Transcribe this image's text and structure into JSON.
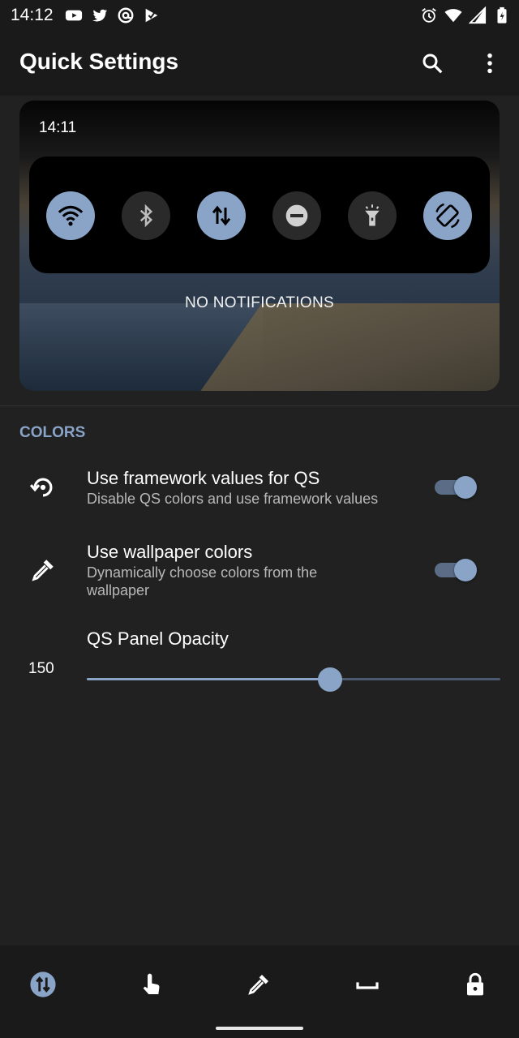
{
  "status_bar": {
    "time": "14:12",
    "left_icons": [
      "youtube-icon",
      "twitter-icon",
      "at-sign-icon",
      "check-play-icon"
    ],
    "right_icons": [
      "alarm-icon",
      "wifi-icon",
      "signal-icon",
      "battery-icon"
    ]
  },
  "app_bar": {
    "title": "Quick Settings",
    "actions": [
      "search-icon",
      "more-vert-icon"
    ]
  },
  "preview": {
    "time": "14:11",
    "tiles": [
      {
        "icon": "wifi-icon",
        "state": "on"
      },
      {
        "icon": "bluetooth-icon",
        "state": "off"
      },
      {
        "icon": "mobile-data-icon",
        "state": "on"
      },
      {
        "icon": "do-not-disturb-icon",
        "state": "off"
      },
      {
        "icon": "flashlight-icon",
        "state": "off"
      },
      {
        "icon": "auto-rotate-icon",
        "state": "on"
      }
    ],
    "empty_text": "NO NOTIFICATIONS"
  },
  "colors_section": {
    "header": "COLORS",
    "prefs": [
      {
        "icon": "restore-icon",
        "title": "Use framework values for QS",
        "summary": "Disable QS colors and use framework values",
        "enabled": true
      },
      {
        "icon": "eyedropper-icon",
        "title": "Use wallpaper colors",
        "summary": "Dynamically choose colors from the wallpaper",
        "enabled": true
      }
    ],
    "opacity": {
      "title": "QS Panel Opacity",
      "value": "150",
      "max": 255
    }
  },
  "bottom_nav": {
    "items": [
      {
        "icon": "tiles-icon",
        "active": true
      },
      {
        "icon": "touch-icon",
        "active": false
      },
      {
        "icon": "eyedropper-icon",
        "active": false
      },
      {
        "icon": "space-bar-icon",
        "active": false
      },
      {
        "icon": "lock-icon",
        "active": false
      }
    ]
  },
  "theme": {
    "accent": "#8aa4c8",
    "background": "#212121",
    "bar": "#1a1a1a"
  }
}
